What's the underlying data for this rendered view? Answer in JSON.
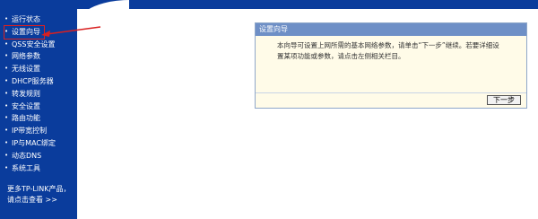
{
  "sidebar": {
    "items": [
      {
        "label": "运行状态",
        "active": false
      },
      {
        "label": "设置向导",
        "active": true
      },
      {
        "label": "QSS安全设置",
        "active": false
      },
      {
        "label": "网络参数",
        "active": false
      },
      {
        "label": "无线设置",
        "active": false
      },
      {
        "label": "DHCP服务器",
        "active": false
      },
      {
        "label": "转发规则",
        "active": false
      },
      {
        "label": "安全设置",
        "active": false
      },
      {
        "label": "路由功能",
        "active": false
      },
      {
        "label": "IP带宽控制",
        "active": false
      },
      {
        "label": "IP与MAC绑定",
        "active": false
      },
      {
        "label": "动态DNS",
        "active": false
      },
      {
        "label": "系统工具",
        "active": false
      }
    ],
    "more_line1": "更多TP-LINK产品，",
    "more_line2": "请点击查看 >>"
  },
  "wizard": {
    "title": "设置向导",
    "body_line1": "本向导可设置上网所需的基本网络参数，请单击“下一步”继续。若要详细设",
    "body_line2": "置某项功能或参数，请点击左侧相关栏目。",
    "next_label": "下一步"
  },
  "colors": {
    "sidebar_bg": "#0a3c9c",
    "panel_header": "#6e8fc6",
    "panel_bg": "#fffbe8",
    "highlight": "#d92020"
  }
}
